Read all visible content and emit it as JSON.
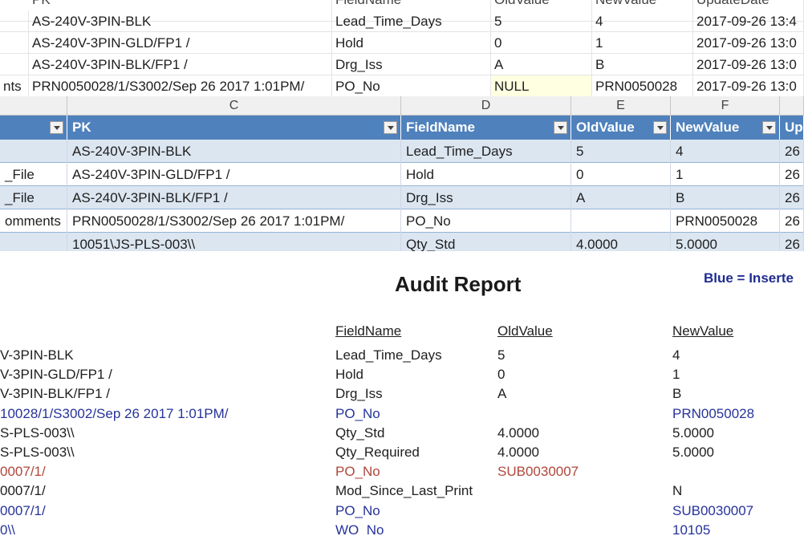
{
  "sql_grid": {
    "headers": [
      "PK",
      "FieldName",
      "OldValue",
      "NewValue",
      "UpdateDate"
    ],
    "rows": [
      {
        "left": "",
        "pk": "AS-240V-3PIN-BLK",
        "field": "Lead_Time_Days",
        "old": "5",
        "new": "4",
        "date": "2017-09-26 13:4"
      },
      {
        "left": "",
        "pk": "AS-240V-3PIN-GLD/FP1  /",
        "field": "Hold",
        "old": "0",
        "new": "1",
        "date": "2017-09-26 13:0"
      },
      {
        "left": "",
        "pk": "AS-240V-3PIN-BLK/FP1  /",
        "field": "Drg_Iss",
        "old": "A",
        "new": "B",
        "date": "2017-09-26 13:0"
      },
      {
        "left": "nts",
        "pk": "PRN0050028/1/S3002/Sep 26 2017  1:01PM/",
        "field": "PO_No",
        "old": "NULL",
        "new": "PRN0050028",
        "date": "2017-09-26 13:0"
      }
    ]
  },
  "excel": {
    "column_letters": [
      "C",
      "D",
      "E",
      "F"
    ],
    "headers": [
      "PK",
      "FieldName",
      "OldValue",
      "NewValue",
      "Up"
    ],
    "rows": [
      {
        "a": "",
        "pk": "AS-240V-3PIN-BLK",
        "field": "Lead_Time_Days",
        "old": "5",
        "new": "4",
        "up": "26"
      },
      {
        "a": "_File",
        "pk": "AS-240V-3PIN-GLD/FP1  /",
        "field": "Hold",
        "old": "0",
        "new": "1",
        "up": "26"
      },
      {
        "a": "_File",
        "pk": "AS-240V-3PIN-BLK/FP1  /",
        "field": "Drg_Iss",
        "old": "A",
        "new": "B",
        "up": "26"
      },
      {
        "a": "omments",
        "pk": "PRN0050028/1/S3002/Sep 26 2017  1:01PM/",
        "field": "PO_No",
        "old": "",
        "new": "PRN0050028",
        "up": "26"
      },
      {
        "a": "",
        "pk": "10051\\JS-PLS-003\\\\",
        "field": "Qty_Std",
        "old": "4.0000",
        "new": "5.0000",
        "up": "26"
      }
    ]
  },
  "report": {
    "title": "Audit Report",
    "legend": "Blue = Inserte",
    "headers": [
      "FieldName",
      "OldValue",
      "NewValue"
    ],
    "colors": {
      "black": "#1e1e1e",
      "blue": "#26339a",
      "red": "#b0463a"
    },
    "rows": [
      {
        "pk": "V-3PIN-BLK",
        "field": "Lead_Time_Days",
        "old": "5",
        "new": "4",
        "pk_color": "black",
        "field_color": "black",
        "old_color": "black",
        "new_color": "black"
      },
      {
        "pk": "V-3PIN-GLD/FP1  /",
        "field": "Hold",
        "old": "0",
        "new": "1",
        "pk_color": "black",
        "field_color": "black",
        "old_color": "black",
        "new_color": "black"
      },
      {
        "pk": "V-3PIN-BLK/FP1  /",
        "field": "Drg_Iss",
        "old": "A",
        "new": "B",
        "pk_color": "black",
        "field_color": "black",
        "old_color": "black",
        "new_color": "black"
      },
      {
        "pk": "10028/1/S3002/Sep 26 2017  1:01PM/",
        "field": "PO_No",
        "old": "",
        "new": "PRN0050028",
        "pk_color": "blue",
        "field_color": "blue",
        "old_color": "blue",
        "new_color": "blue"
      },
      {
        "pk": "S-PLS-003\\\\",
        "field": "Qty_Std",
        "old": "4.0000",
        "new": "5.0000",
        "pk_color": "black",
        "field_color": "black",
        "old_color": "black",
        "new_color": "black"
      },
      {
        "pk": "S-PLS-003\\\\",
        "field": "Qty_Required",
        "old": "4.0000",
        "new": "5.0000",
        "pk_color": "black",
        "field_color": "black",
        "old_color": "black",
        "new_color": "black"
      },
      {
        "pk": "0007/1/",
        "field": "PO_No",
        "old": "SUB0030007",
        "new": "",
        "pk_color": "red",
        "field_color": "red",
        "old_color": "red",
        "new_color": "red"
      },
      {
        "pk": "0007/1/",
        "field": "Mod_Since_Last_Print",
        "old": "",
        "new": "N",
        "pk_color": "black",
        "field_color": "black",
        "old_color": "black",
        "new_color": "black"
      },
      {
        "pk": "0007/1/",
        "field": "PO_No",
        "old": "",
        "new": "SUB0030007",
        "pk_color": "blue",
        "field_color": "blue",
        "old_color": "blue",
        "new_color": "blue"
      },
      {
        "pk": "0\\\\",
        "field": "WO_No",
        "old": "",
        "new": "10105",
        "pk_color": "blue",
        "field_color": "blue",
        "old_color": "blue",
        "new_color": "blue"
      }
    ]
  }
}
